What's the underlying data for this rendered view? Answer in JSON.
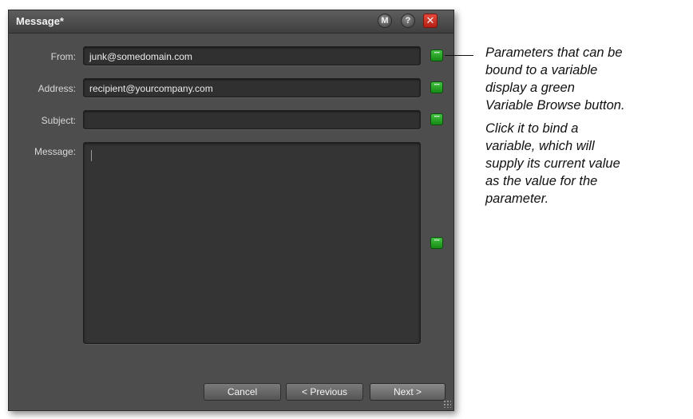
{
  "dialog": {
    "title": "Message*",
    "title_buttons": {
      "m": "M",
      "help": "?",
      "close": "✕"
    },
    "rows": {
      "from": {
        "label": "From:",
        "value": "junk@somedomain.com"
      },
      "address": {
        "label": "Address:",
        "value": "recipient@yourcompany.com"
      },
      "subject": {
        "label": "Subject:",
        "value": ""
      },
      "message": {
        "label": "Message:",
        "value": ""
      }
    },
    "variable_button_glyph": "···",
    "buttons": {
      "cancel": "Cancel",
      "previous": "< Previous",
      "next": "Next >"
    }
  },
  "annotations": {
    "note1": [
      "Parameters that can be",
      "bound to a variable",
      "display a green",
      "Variable Browse button."
    ],
    "note2": [
      "Click it to bind a",
      "variable, which will",
      "supply its current value",
      "as the value for the",
      "parameter."
    ]
  },
  "colors": {
    "accent_green": "#2aa52a",
    "close_red": "#d0352a",
    "dialog_bg": "#4d4d4d"
  }
}
